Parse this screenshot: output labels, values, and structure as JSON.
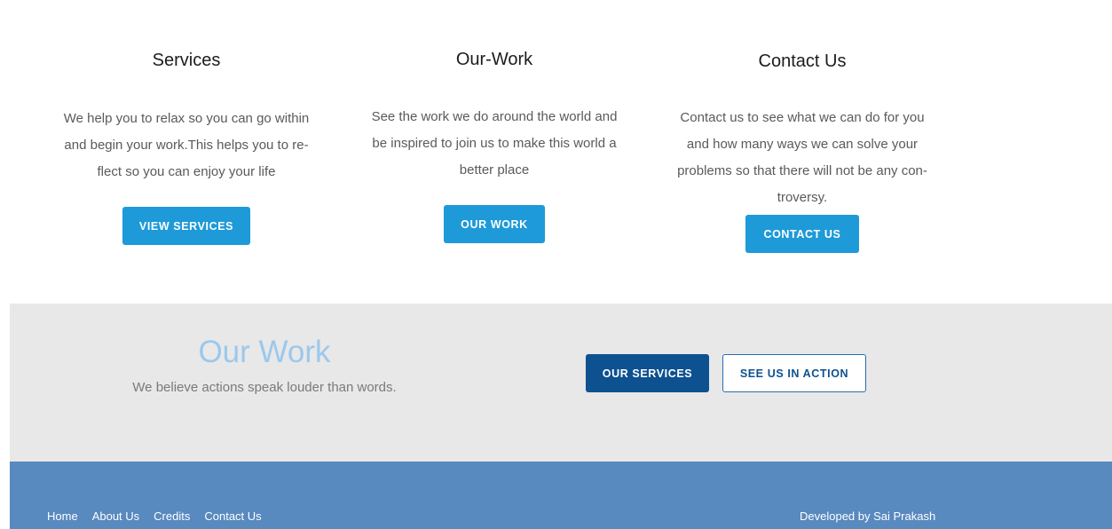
{
  "features": {
    "services": {
      "title": "Services",
      "lines": [
        "We help you to relax so you can go within",
        "and begin your work.This helps you to re-",
        "flect so you can enjoy your life"
      ],
      "button": "VIEW SERVICES"
    },
    "ourwork": {
      "title": "Our-Work",
      "lines": [
        "See the work we do around the world and",
        "be inspired to join us to make this world a",
        "better place"
      ],
      "button": "OUR WORK"
    },
    "contact": {
      "title": "Contact Us",
      "lines": [
        "Contact us to see what we can do for you",
        "and how many ways we can solve your",
        "problems so that there will not be any con-",
        "troversy."
      ],
      "button": "CONTACT US"
    }
  },
  "banner": {
    "title": "Our Work",
    "subtitle": "We believe actions speak louder than words.",
    "primary_button": "OUR SERVICES",
    "secondary_button": "SEE US IN ACTION"
  },
  "footer": {
    "links": [
      "Home",
      "About Us",
      "Credits",
      "Contact Us"
    ],
    "credit": "Developed by Sai Prakash"
  },
  "colors": {
    "accent_blue": "#1e9ad8",
    "dark_blue": "#0d5190",
    "banner_title": "#9cc8ec",
    "banner_bg": "#e8e8e8",
    "footer_bg": "#5889bf"
  }
}
